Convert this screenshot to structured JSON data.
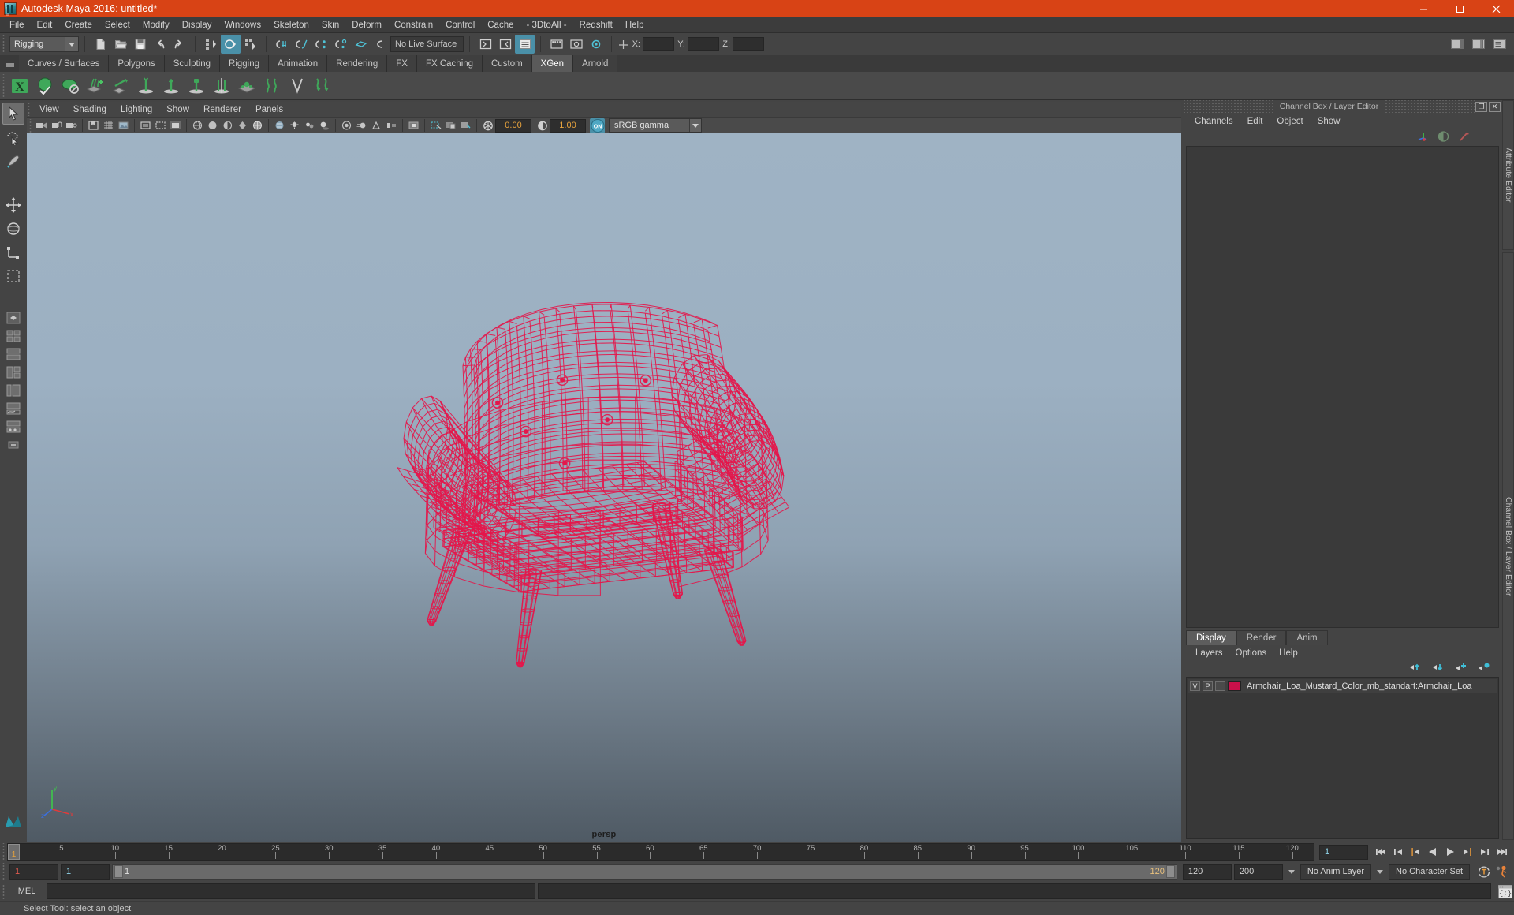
{
  "window": {
    "title": "Autodesk Maya 2016: untitled*",
    "app_icon": "maya-icon",
    "minimize_label": "–",
    "maximize_label": "❐",
    "close_label": "✕",
    "titlebar_color": "#d84315"
  },
  "menubar": {
    "items": [
      "File",
      "Edit",
      "Create",
      "Select",
      "Modify",
      "Display",
      "Windows",
      "Skeleton",
      "Skin",
      "Deform",
      "Constrain",
      "Control",
      "Cache",
      "- 3DtoAll -",
      "Redshift",
      "Help"
    ]
  },
  "statusline": {
    "menuset": "Rigging",
    "live_surface": "No Live Surface",
    "coords": {
      "x_label": "X:",
      "y_label": "Y:",
      "z_label": "Z:",
      "x_value": "",
      "y_value": "",
      "z_value": ""
    },
    "file_buttons": [
      "new-scene-icon",
      "open-scene-icon",
      "save-scene-icon",
      "undo-icon",
      "redo-icon"
    ],
    "select_mode_buttons": [
      "select-by-hierarchy-icon",
      "select-by-object-icon",
      "select-by-component-icon"
    ],
    "snap_buttons": [
      "snap-to-grid-icon",
      "snap-to-curve-icon",
      "snap-to-point-icon",
      "snap-to-projected-center-icon",
      "snap-to-view-plane-icon",
      "make-live-icon"
    ],
    "editor_buttons": [
      "show-hide-attribute-editor-icon",
      "show-hide-tool-settings-icon",
      "show-hide-channel-box-icon"
    ],
    "render_buttons": [
      "render-current-frame-icon",
      "ipr-render-icon",
      "render-settings-icon",
      "hypershade-icon"
    ]
  },
  "shelf": {
    "tabs": [
      "Curves / Surfaces",
      "Polygons",
      "Sculpting",
      "Rigging",
      "Animation",
      "Rendering",
      "FX",
      "FX Caching",
      "Custom",
      "XGen",
      "Arnold"
    ],
    "selected_tab": "XGen",
    "icons": [
      "xgen-editor-icon",
      "xgen-preview-icon",
      "xgen-render-icon",
      "xgen-add-description-icon",
      "xgen-import-collection-icon",
      "xgen-density-brush-icon",
      "xgen-length-brush-icon",
      "xgen-lock-brush-icon",
      "xgen-part-brush-icon",
      "xgen-clump-icon",
      "xgen-noise-icon",
      "xgen-cut-icon",
      "xgen-sculpt-icon"
    ]
  },
  "toolbox": {
    "tools": [
      "select-tool-icon",
      "lasso-select-tool-icon",
      "paint-select-tool-icon",
      "move-tool-icon",
      "rotate-tool-icon",
      "scale-tool-icon",
      "last-tool-icon"
    ],
    "layouts": [
      "single-perspective-layout-icon",
      "four-view-layout-icon",
      "two-panes-stacked-icon",
      "three-panes-split-icon",
      "outliner-persp-layout-icon",
      "persp-graph-layout-icon",
      "hypershade-persp-layout-icon",
      "more-layouts-icon"
    ],
    "logo": "maya-logo-icon"
  },
  "viewport": {
    "menus": [
      "View",
      "Shading",
      "Lighting",
      "Show",
      "Renderer",
      "Panels"
    ],
    "camera_label": "persp",
    "toolbar": {
      "exposure_value": "0.00",
      "gamma_value": "1.00",
      "color_management_toggle": "ON",
      "color_profile": "sRGB gamma",
      "buttons": [
        "select-camera-icon",
        "lock-camera-icon",
        "camera-attributes-icon",
        "bookmarks-icon",
        "image-plane-icon",
        "two-sided-lighting-icon",
        "shadows-icon",
        "ao-icon",
        "motion-blur-icon",
        "grid-toggle-icon",
        "film-gate-icon",
        "resolution-gate-icon",
        "gate-mask-icon",
        "wireframe-icon",
        "smooth-shade-all-icon",
        "smooth-shade-selected-icon",
        "flat-shade-icon",
        "shaded-wireframe-icon",
        "textured-icon",
        "use-default-lighting-icon",
        "use-all-lights-icon",
        "shadows-toggle-icon",
        "screen-space-ao-icon",
        "motion-blur-toggle-icon",
        "multisample-aa-icon",
        "depth-of-field-icon",
        "isolate-select-icon",
        "xray-icon",
        "xray-joints-icon",
        "exposure-icon",
        "gamma-icon"
      ]
    },
    "model": {
      "name": "Armchair wireframe",
      "wireframe_color": "#e4174b",
      "background_top": "#9fb3c4",
      "background_bottom": "#4f5a64"
    },
    "axis_gizmo": {
      "x_label": "x",
      "y_label": "y",
      "z_label": "z"
    }
  },
  "channel_box": {
    "panel_title": "Channel Box / Layer Editor",
    "undock_label": "❐",
    "close_label": "✕",
    "menus": [
      "Channels",
      "Edit",
      "Object",
      "Show"
    ],
    "icons": [
      "channel-box-icon",
      "attribute-editor-icon",
      "tool-settings-icon"
    ]
  },
  "layer_editor": {
    "tabs": [
      "Display",
      "Render",
      "Anim"
    ],
    "selected_tab": "Display",
    "menus": [
      "Layers",
      "Options",
      "Help"
    ],
    "tool_icons": [
      "move-layer-up-icon",
      "move-layer-down-icon",
      "new-layer-icon",
      "new-layer-from-selected-icon"
    ],
    "layers": [
      {
        "visibility": "V",
        "playback": "P",
        "type_box": "",
        "color": "#c9104a",
        "name": "Armchair_Loa_Mustard_Color_mb_standart:Armchair_Loa"
      }
    ]
  },
  "right_vertical_tabs": [
    "Attribute Editor",
    "Channel Box / Layer Editor"
  ],
  "timeline": {
    "start_frame": "1",
    "current_frame": "1",
    "end_frame": "120",
    "playback_start": "1",
    "playback_end": "120",
    "range_start": "1",
    "range_end": "200",
    "ticks": [
      5,
      10,
      15,
      20,
      25,
      30,
      35,
      40,
      45,
      50,
      55,
      60,
      65,
      70,
      75,
      80,
      85,
      90,
      95,
      100,
      105,
      110,
      115,
      120
    ],
    "current_frame_field": "1",
    "playback_controls": [
      "go-to-start-icon",
      "step-back-keyframe-icon",
      "step-back-frame-icon",
      "play-backwards-icon",
      "play-forwards-icon",
      "step-forward-frame-icon",
      "step-forward-keyframe-icon",
      "go-to-end-icon"
    ],
    "anim_layer": "No Anim Layer",
    "character_set": "No Character Set",
    "anim_preferences_icon": "animation-preferences-icon",
    "playback_toggle_icon": "auto-keyframe-icon"
  },
  "command_line": {
    "label": "MEL",
    "input_value": "",
    "output_value": "",
    "script_editor_icon": "script-editor-icon"
  },
  "help_line": {
    "text": "Select Tool: select an object"
  }
}
